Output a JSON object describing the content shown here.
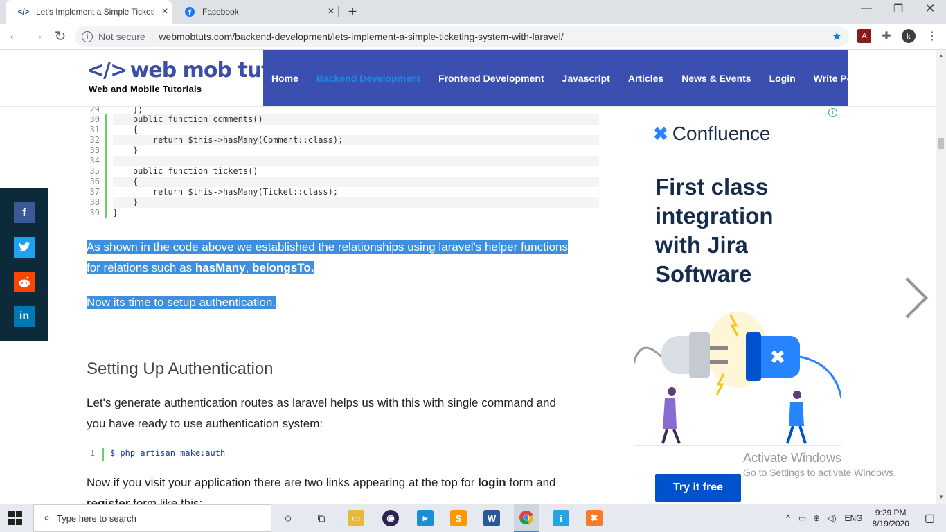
{
  "browser": {
    "tabs": [
      {
        "title": "Let's Implement a Simple Ticketing",
        "active": true,
        "icon": "code-icon"
      },
      {
        "title": "Facebook",
        "active": false,
        "icon": "facebook-icon"
      }
    ],
    "security_label": "Not secure",
    "url": "webmobtuts.com/backend-development/lets-implement-a-simple-ticketing-system-with-laravel/",
    "profile_initial": "k"
  },
  "site": {
    "logo_mark": "</>",
    "logo_name": "web mob tuts",
    "tagline": "Web and Mobile Tutorials",
    "nav": [
      "Home",
      "Backend Development",
      "Frontend Development",
      "Javascript",
      "Articles",
      "News & Events",
      "Login",
      "Write Post"
    ],
    "current_nav": "Backend Development"
  },
  "code_block": {
    "lines": [
      {
        "n": "29",
        "src": "    ];"
      },
      {
        "n": "30",
        "src": "    public function comments()"
      },
      {
        "n": "31",
        "src": "    {"
      },
      {
        "n": "32",
        "src": "        return $this->hasMany(Comment::class);"
      },
      {
        "n": "33",
        "src": "    }"
      },
      {
        "n": "34",
        "src": ""
      },
      {
        "n": "35",
        "src": "    public function tickets()"
      },
      {
        "n": "36",
        "src": "    {"
      },
      {
        "n": "37",
        "src": "        return $this->hasMany(Ticket::class);"
      },
      {
        "n": "38",
        "src": "    }"
      },
      {
        "n": "39",
        "src": "}"
      }
    ]
  },
  "article": {
    "p1_a": "As shown in the code above we established the relationships using laravel's helper functions",
    "p1_b": "for relations such as ",
    "p1_has_many": "hasMany",
    "p1_comma": ", ",
    "p1_belongs_to": "belongsTo.",
    "p2": "Now its time to setup authentication.",
    "section_heading": "Setting Up Authentication",
    "p3_a": "Let's generate authentication routes as laravel helps us with this with single command and",
    "p3_b": "you have ready to use authentication system:",
    "cmd_line_no": "1",
    "cmd": "$ php artisan make:auth",
    "p4_a": "Now if you visit your application there are two links appearing at the top for ",
    "p4_login": "login",
    "p4_b": " form and",
    "p4_register": "register",
    "p4_c": " form like this:"
  },
  "ad": {
    "brand": "Confluence",
    "headline": "First class integration with Jira Software",
    "cta": "Try it free"
  },
  "watermark": {
    "line1": "Activate Windows",
    "line2": "Go to Settings to activate Windows."
  },
  "share": [
    "facebook-icon",
    "twitter-icon",
    "reddit-icon",
    "linkedin-icon"
  ],
  "taskbar": {
    "search_placeholder": "Type here to search",
    "language": "ENG",
    "time": "9:29 PM",
    "date": "8/19/2020"
  }
}
